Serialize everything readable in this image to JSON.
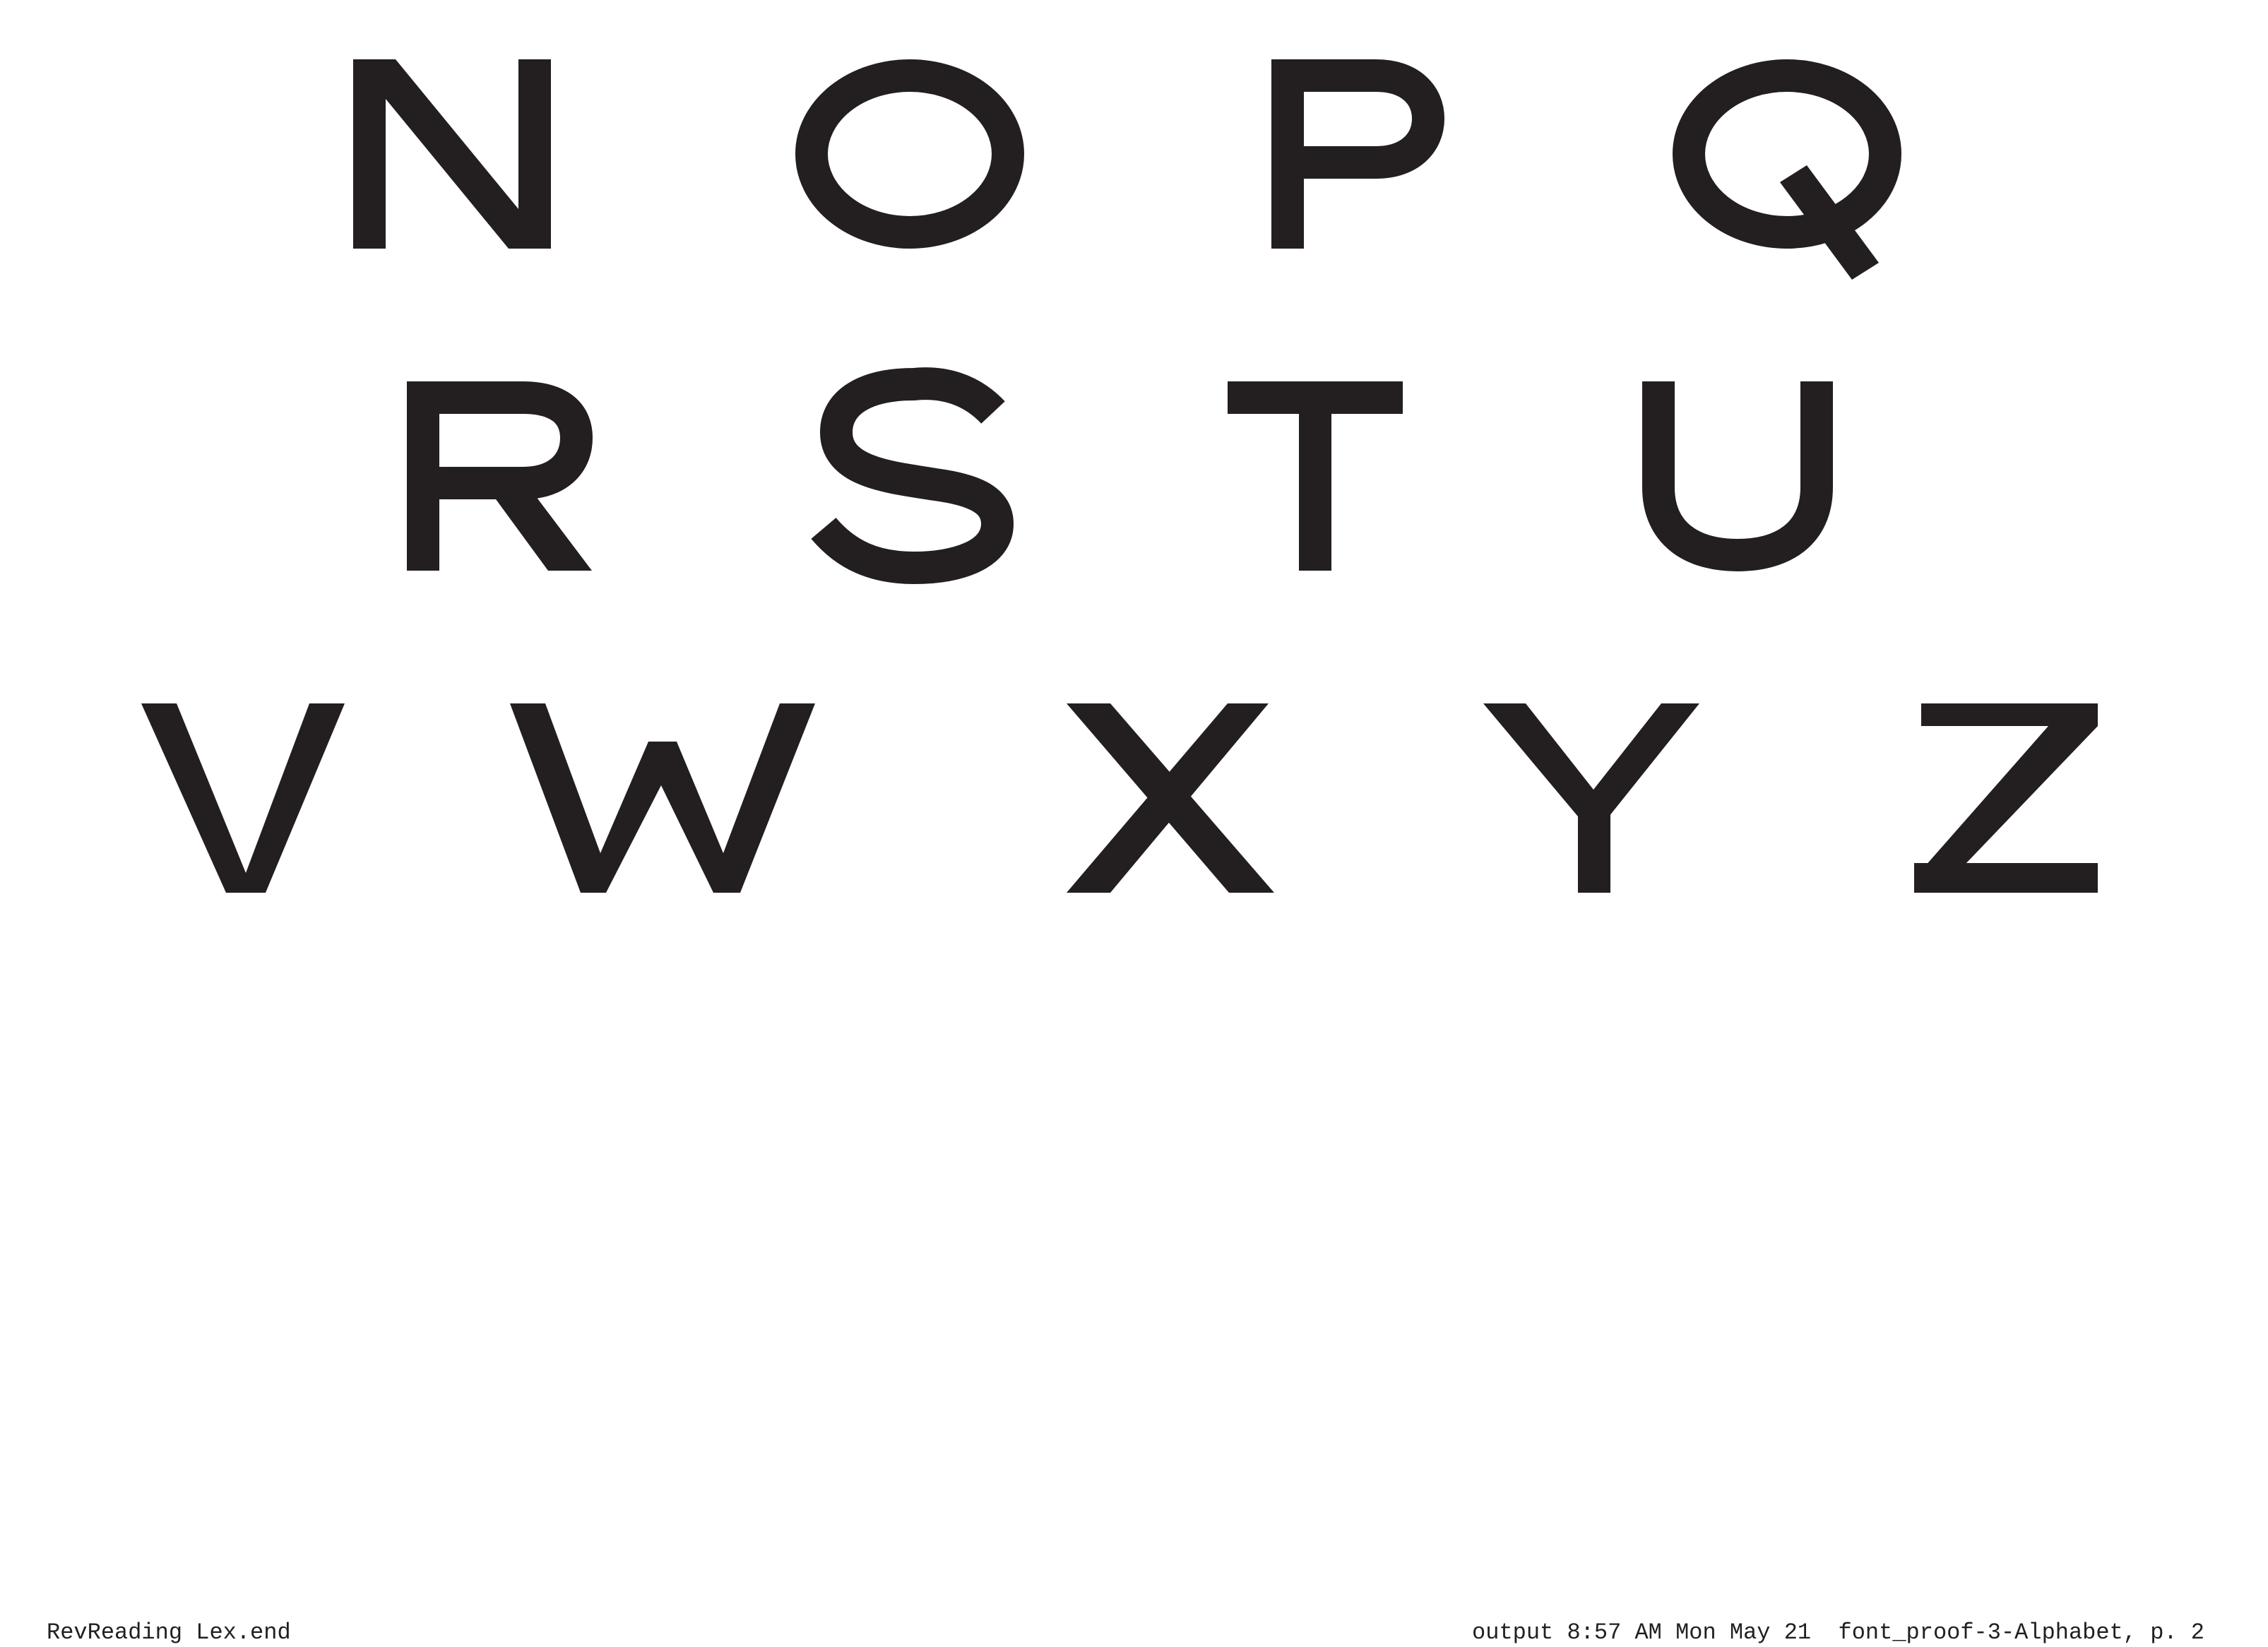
{
  "page": {
    "ink_color": "#231f20",
    "background_color": "#ffffff"
  },
  "glyph_rows": [
    [
      "N",
      "O",
      "P",
      "Q"
    ],
    [
      "R",
      "S",
      "T",
      "U"
    ],
    [
      "V",
      "W",
      "X",
      "Y",
      "Z"
    ]
  ],
  "footer": {
    "left_text": "RevReading Lex.end",
    "right_text": "output 8:57 AM Mon May 21  font_proof-3-Alphabet, p. 2"
  }
}
